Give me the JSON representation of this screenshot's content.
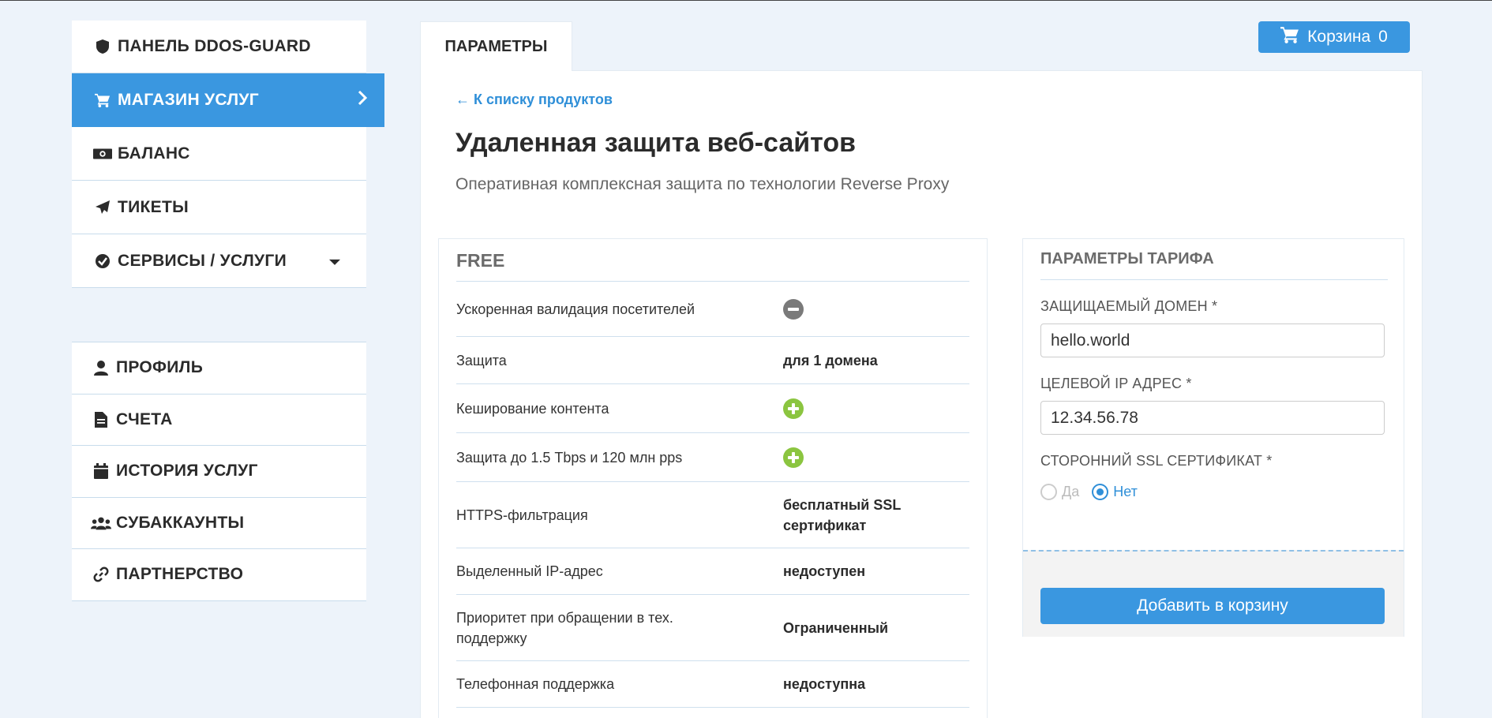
{
  "sidebar": {
    "primary": [
      {
        "label": "ПАНЕЛЬ DDOS-GUARD",
        "icon": "shield-icon"
      },
      {
        "label": "МАГАЗИН УСЛУГ",
        "icon": "cart-icon",
        "active": true
      },
      {
        "label": "БАЛАНС",
        "icon": "money-icon"
      },
      {
        "label": "ТИКЕТЫ",
        "icon": "paper-plane-icon"
      },
      {
        "label": "СЕРВИСЫ / УСЛУГИ",
        "icon": "check-circle-icon"
      }
    ],
    "secondary": [
      {
        "label": "ПРОФИЛЬ",
        "icon": "user-icon"
      },
      {
        "label": "СЧЕТА",
        "icon": "file-icon"
      },
      {
        "label": "ИСТОРИЯ УСЛУГ",
        "icon": "calendar-icon"
      },
      {
        "label": "СУБАККАУНТЫ",
        "icon": "users-icon"
      },
      {
        "label": "ПАРТНЕРСТВО",
        "icon": "link-icon"
      }
    ]
  },
  "tab": {
    "label": "ПАРАМЕТРЫ"
  },
  "cart": {
    "label": "Корзина",
    "count": "0"
  },
  "main": {
    "back_link": "← К списку продуктов",
    "title": "Удаленная защита веб-сайтов",
    "subtitle": "Оперативная комплексная защита по технологии Reverse Proxy"
  },
  "plan": {
    "name": "FREE",
    "rows": [
      {
        "label": "Ускоренная валидация посетителей",
        "value": "",
        "icon": "minus"
      },
      {
        "label": "Защита",
        "value": "для 1 домена"
      },
      {
        "label": "Кеширование контента",
        "value": "",
        "icon": "plus"
      },
      {
        "label": "Защита до 1.5 Tbps и 120 млн pps",
        "value": "",
        "icon": "plus"
      },
      {
        "label": "HTTPS-фильтрация",
        "value": "бесплатный SSL сертификат"
      },
      {
        "label": "Выделенный IP-адрес",
        "value": "недоступен"
      },
      {
        "label": "Приоритет при обращении в тех. поддержку",
        "value": "Ограниченный"
      },
      {
        "label": "Телефонная поддержка",
        "value": "недоступна"
      }
    ]
  },
  "tariff": {
    "title": "ПАРАМЕТРЫ ТАРИФА",
    "domain_label": "ЗАЩИЩАЕМЫЙ ДОМЕН *",
    "domain_value": "hello.world",
    "ip_label": "ЦЕЛЕВОЙ IP АДРЕС *",
    "ip_value": "12.34.56.78",
    "ssl_label": "СТОРОННИЙ SSL СЕРТИФИКАТ *",
    "ssl_options": [
      "Да",
      "Нет"
    ],
    "ssl_selected": "Нет",
    "add_button": "Добавить в корзину"
  },
  "colors": {
    "accent": "#3a97e0",
    "background": "#edf3fa",
    "plus": "#8bc540",
    "minus": "#7a7a7a"
  }
}
